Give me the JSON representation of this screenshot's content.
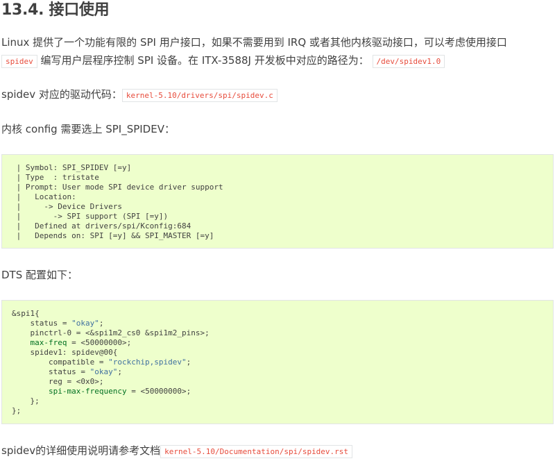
{
  "heading": "13.4. 接口使用",
  "intro": {
    "line1": "Linux 提供了一个功能有限的 SPI 用户接口，如果不需要用到 IRQ 或者其他内核驱动接口，可以考虑使用接口",
    "code_spidev": "spidev",
    "line2_text": "编写用户层程序控制 SPI 设备。在 ITX-3588J 开发板中对应的路径为：",
    "code_path": "/dev/spidev1.0"
  },
  "driver": {
    "text": "spidev 对应的驱动代码：",
    "code": "kernel-5.10/drivers/spi/spidev.c"
  },
  "kconfig_intro": "内核 config 需要选上 SPI_SPIDEV：",
  "kconfig_block": " | Symbol: SPI_SPIDEV [=y]\n | Type  : tristate\n | Prompt: User mode SPI device driver support\n |   Location:\n |     -> Device Drivers\n |       -> SPI support (SPI [=y])\n |   Defined at drivers/spi/Kconfig:684\n |   Depends on: SPI [=y] && SPI_MASTER [=y]",
  "dts_intro": "DTS 配置如下：",
  "dts_block": {
    "l1": "&spi1{",
    "l2a": "    status = ",
    "l2b": "\"okay\"",
    "l2c": ";",
    "l3": "    pinctrl-0 = <&spi1m2_cs0 &spi1m2_pins>;",
    "l4a": "    ",
    "l4b": "max-freq",
    "l4c": " = <50000000>;",
    "l5": "    spidev1: spidev@00{",
    "l6a": "        compatible = ",
    "l6b": "\"rockchip,spidev\"",
    "l6c": ";",
    "l7a": "        status = ",
    "l7b": "\"okay\"",
    "l7c": ";",
    "l8": "        reg = <0x0>;",
    "l9a": "        ",
    "l9b": "spi-max-frequency",
    "l9c": " = <50000000>;",
    "l10": "    };",
    "l11": "};"
  },
  "doc_ref": {
    "text": "spidev的详细使用说明请参考文档",
    "code": "kernel-5.10/Documentation/spi/spidev.rst"
  }
}
